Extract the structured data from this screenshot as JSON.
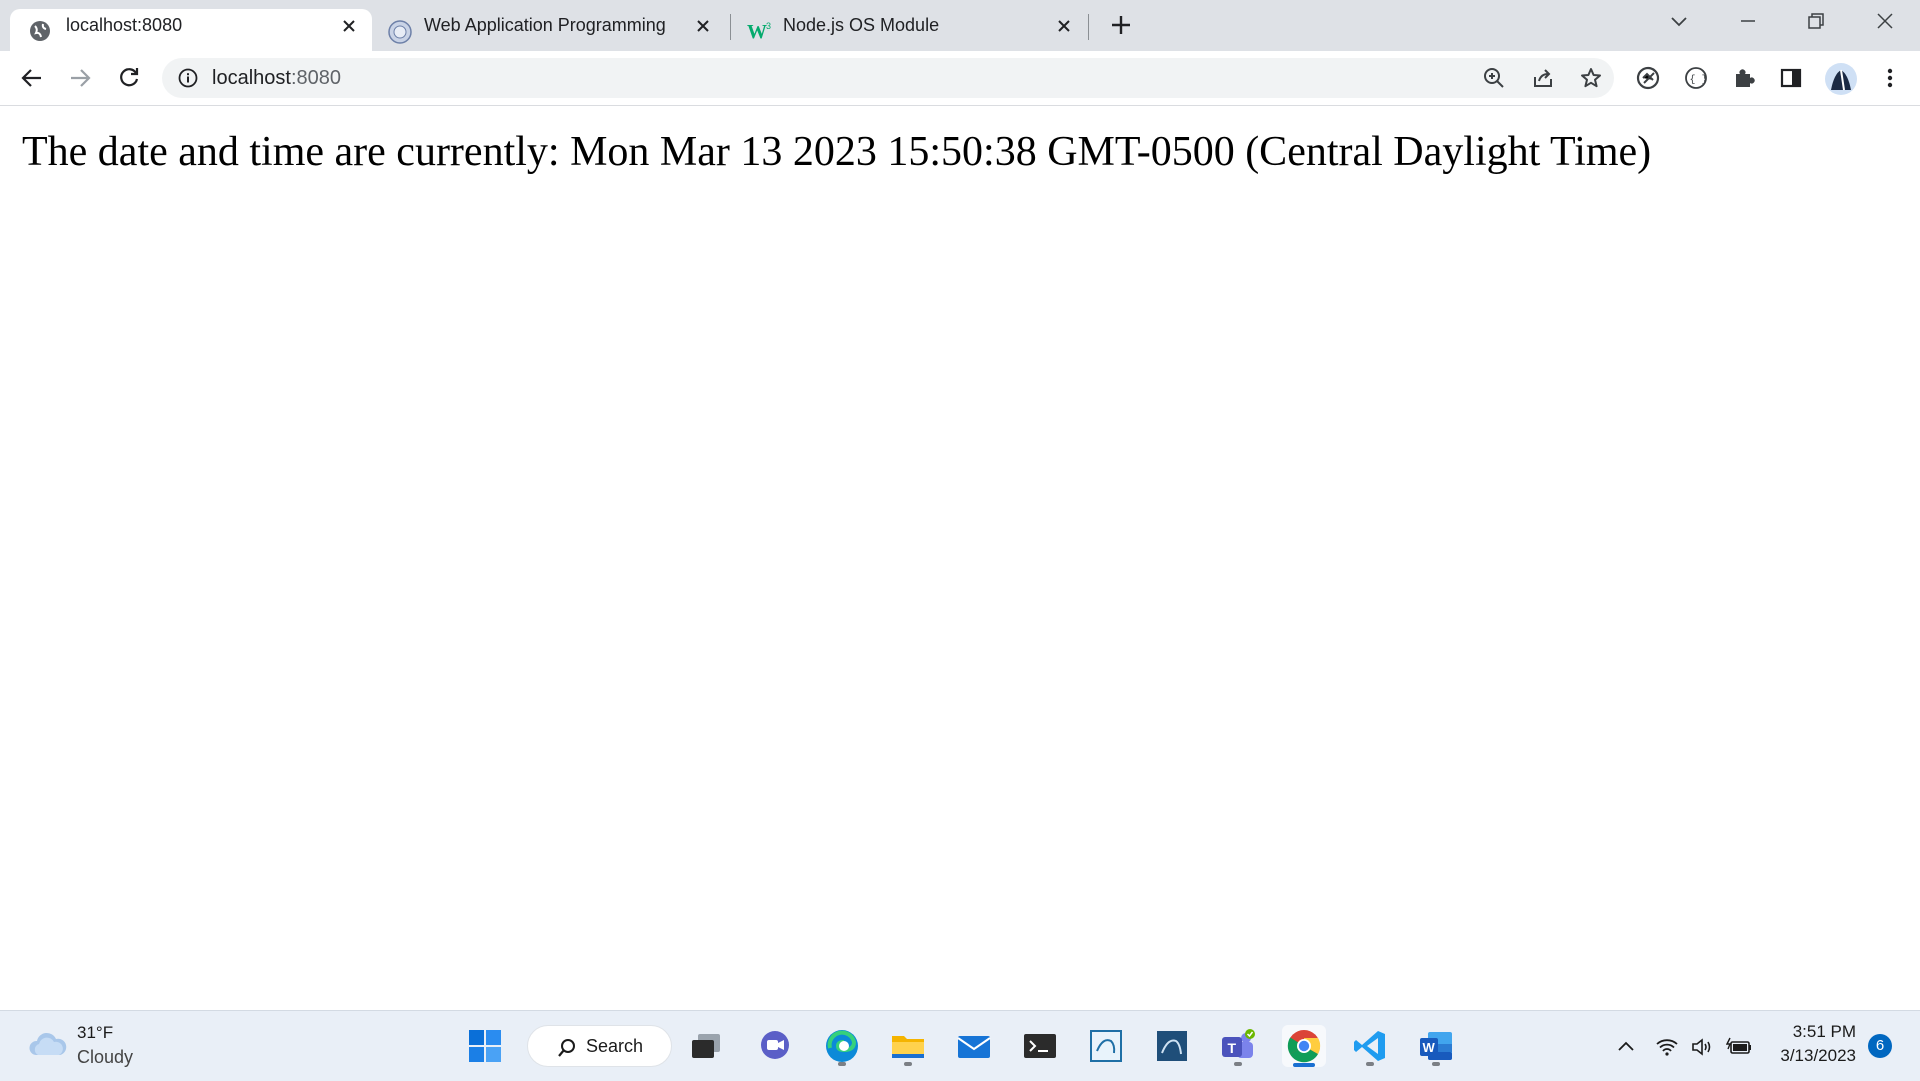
{
  "browser": {
    "tabs": [
      {
        "title": "localhost:8080",
        "active": true,
        "icon": "globe-icon"
      },
      {
        "title": "Web Application Programming",
        "active": false,
        "icon": "university-seal-icon"
      },
      {
        "title": "Node.js OS Module",
        "active": false,
        "icon": "w3schools-icon"
      }
    ],
    "address": {
      "host": "localhost",
      "port": ":8080"
    }
  },
  "page": {
    "text": "The date and time are currently: Mon Mar 13 2023 15:50:38 GMT-0500 (Central Daylight Time)"
  },
  "taskbar": {
    "weather": {
      "temp": "31°F",
      "condition": "Cloudy"
    },
    "search_label": "Search",
    "clock": {
      "time": "3:51 PM",
      "date": "3/13/2023"
    },
    "notification_count": "6"
  },
  "colors": {
    "accent": "#1a6fd1",
    "tab_strip": "#dee1e6",
    "omnibox": "#f1f3f4"
  }
}
